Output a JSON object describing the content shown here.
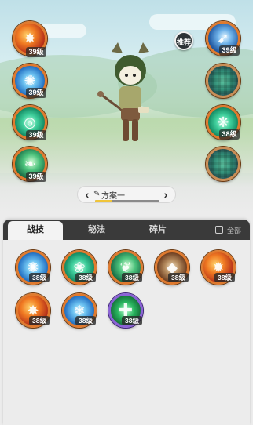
{
  "top_skills_left": [
    {
      "name": "fire",
      "level": "39级"
    },
    {
      "name": "ice",
      "level": "39级"
    },
    {
      "name": "wind",
      "level": "39级"
    },
    {
      "name": "leaf",
      "level": "39级"
    }
  ],
  "top_skills_right": [
    {
      "name": "blue-feather",
      "level": "39级"
    },
    {
      "name": "pixelated-1",
      "level": ""
    },
    {
      "name": "green-rune",
      "level": "38级"
    },
    {
      "name": "pixelated-2",
      "level": ""
    }
  ],
  "recommend_label": "推荐",
  "plan": {
    "label": "方案一",
    "progress": 0.27
  },
  "tabs": [
    {
      "label": "战技",
      "active": true
    },
    {
      "label": "秘法",
      "active": false
    },
    {
      "label": "碎片",
      "active": false
    }
  ],
  "filter_all_label": "全部",
  "panel_skills": [
    {
      "icon": "ice-burst",
      "level": "38级"
    },
    {
      "icon": "wind-slash",
      "level": "38级"
    },
    {
      "icon": "vine-whip",
      "level": "38级"
    },
    {
      "icon": "rock-cards",
      "level": "38级"
    },
    {
      "icon": "fire-blast",
      "level": "38级"
    },
    {
      "icon": "fire-swirl",
      "level": "38级"
    },
    {
      "icon": "ice-shards",
      "level": "38级"
    },
    {
      "icon": "heal-plus",
      "level": "38级"
    }
  ],
  "colors": {
    "accent_ring": "#e07a2e",
    "purple_ring": "#8b62d6",
    "tabbar": "#3a3a3a"
  }
}
